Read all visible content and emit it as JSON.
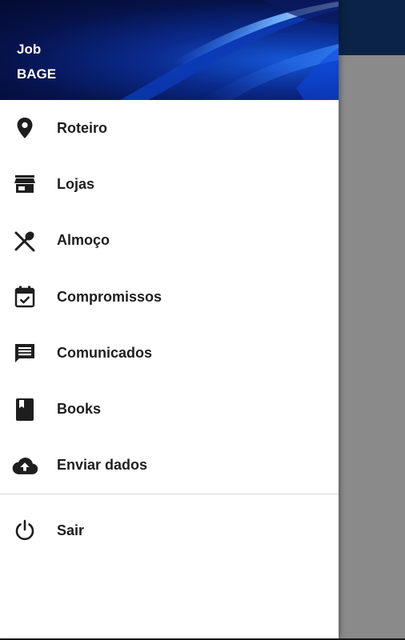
{
  "drawer": {
    "header": {
      "line1": "Job",
      "line2": "BAGE"
    },
    "items": [
      {
        "label": "Roteiro",
        "icon": "location-pin-icon"
      },
      {
        "label": "Lojas",
        "icon": "store-icon"
      },
      {
        "label": "Almoço",
        "icon": "restaurant-icon"
      },
      {
        "label": "Compromissos",
        "icon": "calendar-check-icon"
      },
      {
        "label": "Comunicados",
        "icon": "message-icon"
      },
      {
        "label": "Books",
        "icon": "book-icon"
      },
      {
        "label": "Enviar dados",
        "icon": "cloud-upload-icon"
      }
    ],
    "logout": {
      "label": "Sair",
      "icon": "power-icon"
    }
  },
  "colors": {
    "toolbar": "#0b2346",
    "scrim": "#8a8a8a",
    "icon": "#1e1e1e",
    "text": "#1e1e1e"
  }
}
